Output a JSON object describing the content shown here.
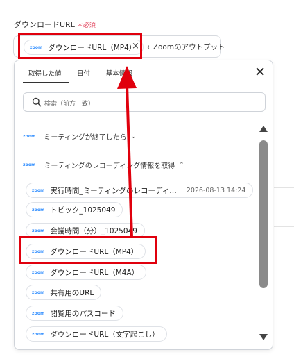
{
  "field": {
    "label": "ダウンロードURL",
    "required_mark": "＊",
    "required_text": "必須",
    "chip_label": "ダウンロードURL（MP4）",
    "chip_brand": "zoom",
    "remove_glyph": "×",
    "hint": "←Zoomのアウトプット"
  },
  "panel": {
    "tabs": [
      "取得した値",
      "日付",
      "基本情報"
    ],
    "active_tab": 0,
    "close_glyph": "✕",
    "search_placeholder": "検索（前方一致）",
    "sections": [
      {
        "brand": "zoom",
        "label": "ミーティングが終了したら",
        "chevron": "⌄",
        "expanded": false
      },
      {
        "brand": "zoom",
        "label": "ミーティングのレコーディング情報を取得",
        "chevron": "⌃",
        "expanded": true
      }
    ],
    "items": [
      {
        "brand": "zoom",
        "label": "実行時間_ミーティングのレコーディ…",
        "timestamp": "2026-08-13 14:24"
      },
      {
        "brand": "zoom",
        "label": "トピック_1025049"
      },
      {
        "brand": "zoom",
        "label": "会議時間（分）_1025049"
      },
      {
        "brand": "zoom",
        "label": "ダウンロードURL（MP4）"
      },
      {
        "brand": "zoom",
        "label": "ダウンロードURL（M4A）"
      },
      {
        "brand": "zoom",
        "label": "共有用のURL"
      },
      {
        "brand": "zoom",
        "label": "閲覧用のパスコード"
      },
      {
        "brand": "zoom",
        "label": "ダウンロードURL（文字起こし）"
      }
    ]
  },
  "colors": {
    "highlight": "#e0000d",
    "zoom_brand": "#2d8cff",
    "required": "#e2445c"
  },
  "icons": {
    "search": "search-icon",
    "close": "close-icon",
    "scroll_up": "triangle-up-icon",
    "scroll_down": "triangle-down-icon"
  }
}
